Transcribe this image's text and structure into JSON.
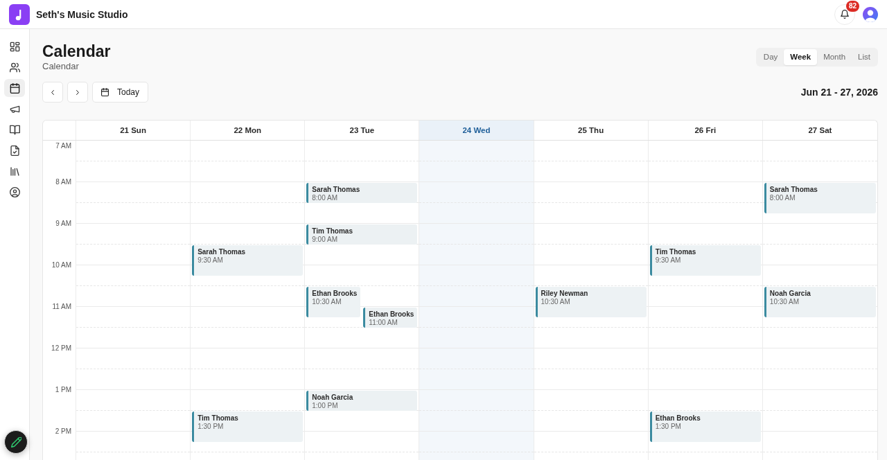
{
  "app": {
    "title": "Seth's Music Studio"
  },
  "notifications": {
    "count": "82"
  },
  "sidebar": {
    "items": [
      {
        "selected": false
      },
      {
        "selected": false
      },
      {
        "selected": true
      },
      {
        "selected": false
      },
      {
        "selected": false
      },
      {
        "selected": false
      },
      {
        "selected": false
      },
      {
        "selected": false
      }
    ]
  },
  "page": {
    "title": "Calendar",
    "subtitle": "Calendar"
  },
  "views": [
    {
      "label": "Day",
      "selected": false
    },
    {
      "label": "Week",
      "selected": true
    },
    {
      "label": "Month",
      "selected": false
    },
    {
      "label": "List",
      "selected": false
    }
  ],
  "toolbar": {
    "today": "Today",
    "range": "Jun 21 - 27, 2026"
  },
  "calendar": {
    "hours": [
      "7 AM",
      "8 AM",
      "9 AM",
      "10 AM",
      "11 AM",
      "12 PM",
      "1 PM",
      "2 PM"
    ],
    "days": [
      {
        "label": "21 Sun",
        "today": false
      },
      {
        "label": "22 Mon",
        "today": false,
        "events": [
          {
            "name": "Sarah Thomas",
            "time": "9:30 AM",
            "kind": "long"
          },
          {
            "name": "Tim Thomas",
            "time": "1:30 PM",
            "kind": "long"
          }
        ]
      },
      {
        "label": "23 Tue",
        "today": false,
        "events": [
          {
            "name": "Sarah Thomas",
            "time": "8:00 AM",
            "kind": "short"
          },
          {
            "name": "Tim Thomas",
            "time": "9:00 AM",
            "kind": "short"
          },
          {
            "name": "Ethan Brooks",
            "time": "10:30 AM",
            "kind": "long"
          },
          {
            "name": "Ethan Brooks",
            "time": "11:00 AM",
            "kind": "short"
          },
          {
            "name": "Noah Garcia",
            "time": "1:00 PM",
            "kind": "short"
          }
        ]
      },
      {
        "label": "24 Wed",
        "today": true
      },
      {
        "label": "25 Thu",
        "today": false,
        "events": [
          {
            "name": "Riley Newman",
            "time": "10:30 AM",
            "kind": "long"
          }
        ]
      },
      {
        "label": "26 Fri",
        "today": false,
        "events": [
          {
            "name": "Tim Thomas",
            "time": "9:30 AM",
            "kind": "long"
          },
          {
            "name": "Ethan Brooks",
            "time": "1:30 PM",
            "kind": "long"
          }
        ]
      },
      {
        "label": "27 Sat",
        "today": false,
        "events": [
          {
            "name": "Sarah Thomas",
            "time": "8:00 AM",
            "kind": "long"
          },
          {
            "name": "Noah Garcia",
            "time": "10:30 AM",
            "kind": "long"
          }
        ]
      }
    ]
  }
}
